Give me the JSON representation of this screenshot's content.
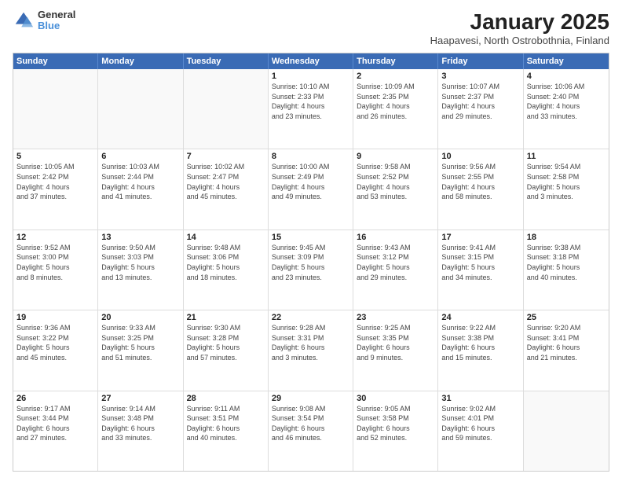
{
  "header": {
    "logo_line1": "General",
    "logo_line2": "Blue",
    "title": "January 2025",
    "subtitle": "Haapavesi, North Ostrobothnia, Finland"
  },
  "weekdays": [
    "Sunday",
    "Monday",
    "Tuesday",
    "Wednesday",
    "Thursday",
    "Friday",
    "Saturday"
  ],
  "rows": [
    [
      {
        "day": "",
        "info": ""
      },
      {
        "day": "",
        "info": ""
      },
      {
        "day": "",
        "info": ""
      },
      {
        "day": "1",
        "info": "Sunrise: 10:10 AM\nSunset: 2:33 PM\nDaylight: 4 hours\nand 23 minutes."
      },
      {
        "day": "2",
        "info": "Sunrise: 10:09 AM\nSunset: 2:35 PM\nDaylight: 4 hours\nand 26 minutes."
      },
      {
        "day": "3",
        "info": "Sunrise: 10:07 AM\nSunset: 2:37 PM\nDaylight: 4 hours\nand 29 minutes."
      },
      {
        "day": "4",
        "info": "Sunrise: 10:06 AM\nSunset: 2:40 PM\nDaylight: 4 hours\nand 33 minutes."
      }
    ],
    [
      {
        "day": "5",
        "info": "Sunrise: 10:05 AM\nSunset: 2:42 PM\nDaylight: 4 hours\nand 37 minutes."
      },
      {
        "day": "6",
        "info": "Sunrise: 10:03 AM\nSunset: 2:44 PM\nDaylight: 4 hours\nand 41 minutes."
      },
      {
        "day": "7",
        "info": "Sunrise: 10:02 AM\nSunset: 2:47 PM\nDaylight: 4 hours\nand 45 minutes."
      },
      {
        "day": "8",
        "info": "Sunrise: 10:00 AM\nSunset: 2:49 PM\nDaylight: 4 hours\nand 49 minutes."
      },
      {
        "day": "9",
        "info": "Sunrise: 9:58 AM\nSunset: 2:52 PM\nDaylight: 4 hours\nand 53 minutes."
      },
      {
        "day": "10",
        "info": "Sunrise: 9:56 AM\nSunset: 2:55 PM\nDaylight: 4 hours\nand 58 minutes."
      },
      {
        "day": "11",
        "info": "Sunrise: 9:54 AM\nSunset: 2:58 PM\nDaylight: 5 hours\nand 3 minutes."
      }
    ],
    [
      {
        "day": "12",
        "info": "Sunrise: 9:52 AM\nSunset: 3:00 PM\nDaylight: 5 hours\nand 8 minutes."
      },
      {
        "day": "13",
        "info": "Sunrise: 9:50 AM\nSunset: 3:03 PM\nDaylight: 5 hours\nand 13 minutes."
      },
      {
        "day": "14",
        "info": "Sunrise: 9:48 AM\nSunset: 3:06 PM\nDaylight: 5 hours\nand 18 minutes."
      },
      {
        "day": "15",
        "info": "Sunrise: 9:45 AM\nSunset: 3:09 PM\nDaylight: 5 hours\nand 23 minutes."
      },
      {
        "day": "16",
        "info": "Sunrise: 9:43 AM\nSunset: 3:12 PM\nDaylight: 5 hours\nand 29 minutes."
      },
      {
        "day": "17",
        "info": "Sunrise: 9:41 AM\nSunset: 3:15 PM\nDaylight: 5 hours\nand 34 minutes."
      },
      {
        "day": "18",
        "info": "Sunrise: 9:38 AM\nSunset: 3:18 PM\nDaylight: 5 hours\nand 40 minutes."
      }
    ],
    [
      {
        "day": "19",
        "info": "Sunrise: 9:36 AM\nSunset: 3:22 PM\nDaylight: 5 hours\nand 45 minutes."
      },
      {
        "day": "20",
        "info": "Sunrise: 9:33 AM\nSunset: 3:25 PM\nDaylight: 5 hours\nand 51 minutes."
      },
      {
        "day": "21",
        "info": "Sunrise: 9:30 AM\nSunset: 3:28 PM\nDaylight: 5 hours\nand 57 minutes."
      },
      {
        "day": "22",
        "info": "Sunrise: 9:28 AM\nSunset: 3:31 PM\nDaylight: 6 hours\nand 3 minutes."
      },
      {
        "day": "23",
        "info": "Sunrise: 9:25 AM\nSunset: 3:35 PM\nDaylight: 6 hours\nand 9 minutes."
      },
      {
        "day": "24",
        "info": "Sunrise: 9:22 AM\nSunset: 3:38 PM\nDaylight: 6 hours\nand 15 minutes."
      },
      {
        "day": "25",
        "info": "Sunrise: 9:20 AM\nSunset: 3:41 PM\nDaylight: 6 hours\nand 21 minutes."
      }
    ],
    [
      {
        "day": "26",
        "info": "Sunrise: 9:17 AM\nSunset: 3:44 PM\nDaylight: 6 hours\nand 27 minutes."
      },
      {
        "day": "27",
        "info": "Sunrise: 9:14 AM\nSunset: 3:48 PM\nDaylight: 6 hours\nand 33 minutes."
      },
      {
        "day": "28",
        "info": "Sunrise: 9:11 AM\nSunset: 3:51 PM\nDaylight: 6 hours\nand 40 minutes."
      },
      {
        "day": "29",
        "info": "Sunrise: 9:08 AM\nSunset: 3:54 PM\nDaylight: 6 hours\nand 46 minutes."
      },
      {
        "day": "30",
        "info": "Sunrise: 9:05 AM\nSunset: 3:58 PM\nDaylight: 6 hours\nand 52 minutes."
      },
      {
        "day": "31",
        "info": "Sunrise: 9:02 AM\nSunset: 4:01 PM\nDaylight: 6 hours\nand 59 minutes."
      },
      {
        "day": "",
        "info": ""
      }
    ]
  ]
}
